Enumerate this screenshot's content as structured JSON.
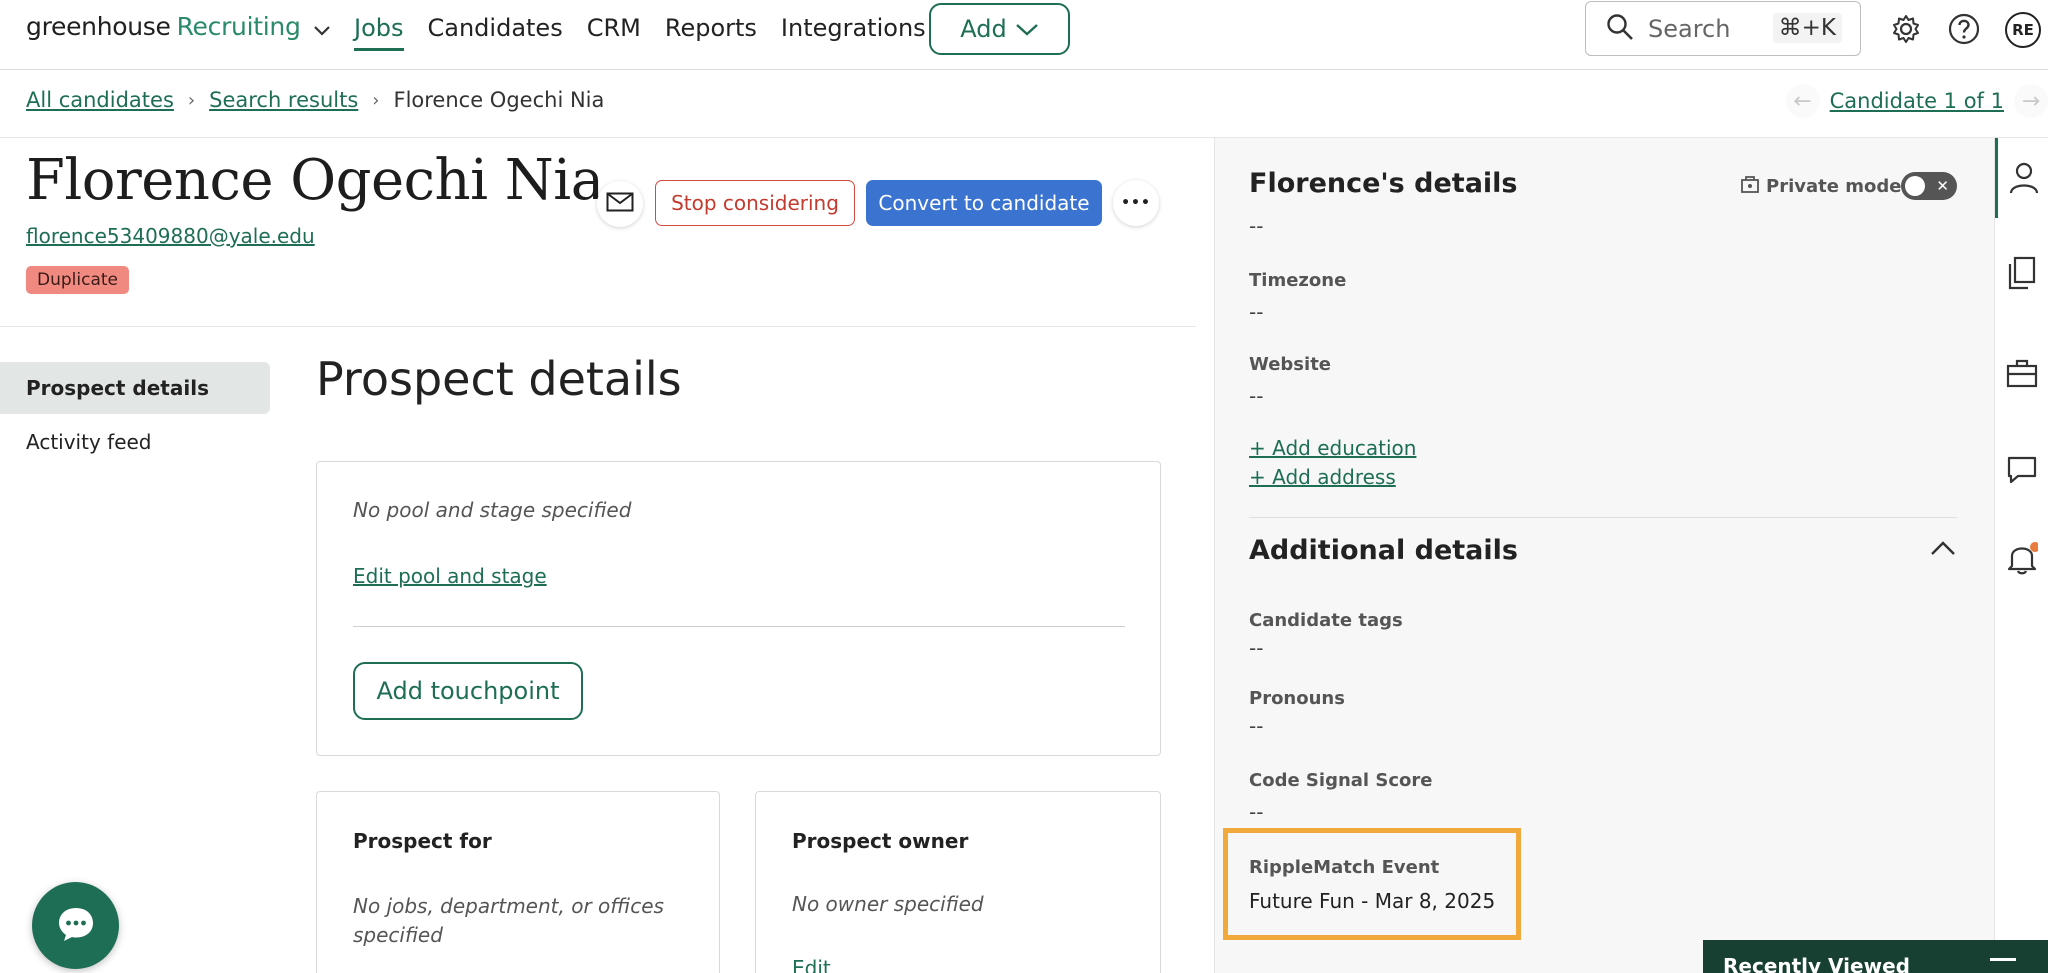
{
  "nav": {
    "logo_main": "greenhouse",
    "logo_accent": "Recruiting",
    "links": [
      "Jobs",
      "Candidates",
      "CRM",
      "Reports",
      "Integrations"
    ],
    "active_link": "Jobs",
    "add_label": "Add",
    "search_placeholder": "Search",
    "search_shortcut": "⌘+K",
    "avatar_initials": "RE",
    "icons": [
      "settings-icon",
      "help-icon"
    ]
  },
  "breadcrumb": {
    "items": [
      "All candidates",
      "Search results"
    ],
    "current": "Florence Ogechi Nia",
    "candidate_counter": "Candidate 1 of 1"
  },
  "candidate": {
    "name": "Florence Ogechi Nia",
    "email": "florence53409880@yale.edu",
    "badge": "Duplicate"
  },
  "actions": {
    "stop_label": "Stop considering",
    "convert_label": "Convert to candidate",
    "more_label": "•••"
  },
  "left_nav": {
    "items": [
      "Prospect details",
      "Activity feed"
    ],
    "selected": "Prospect details"
  },
  "main": {
    "title": "Prospect details",
    "pool_card": {
      "empty_text": "No pool and stage specified",
      "edit_link": "Edit pool and stage",
      "touchpoint_button": "Add touchpoint"
    },
    "prospect_for": {
      "heading": "Prospect for",
      "empty_text": "No jobs, department, or offices specified"
    },
    "prospect_owner": {
      "heading": "Prospect owner",
      "empty_text": "No owner specified",
      "edit_link": "Edit"
    }
  },
  "right_panel": {
    "details_heading": "Florence's details",
    "private_mode_label": "Private mode",
    "private_mode_on": false,
    "first_value": "--",
    "fields": [
      {
        "label": "Timezone",
        "value": "--"
      },
      {
        "label": "Website",
        "value": "--"
      }
    ],
    "links": [
      "+ Add education",
      "+ Add address"
    ],
    "additional_heading": "Additional details",
    "additional_fields": [
      {
        "label": "Candidate tags",
        "value": "--"
      },
      {
        "label": "Pronouns",
        "value": "--"
      },
      {
        "label": "Code Signal Score",
        "value": "--"
      },
      {
        "label": "RippleMatch Event",
        "value": "Future Fun - Mar 8, 2025"
      }
    ],
    "side_tabs": [
      "person-icon",
      "documents-icon",
      "briefcase-icon",
      "comment-icon",
      "bell-icon"
    ]
  },
  "recently_viewed": {
    "label": "Recently Viewed"
  },
  "colors": {
    "brand_green": "#1e6e56",
    "convert_blue": "#3a73d0",
    "stop_red": "#c33a2e",
    "duplicate_badge": "#f08a80",
    "highlight_orange": "#f2a93b"
  }
}
